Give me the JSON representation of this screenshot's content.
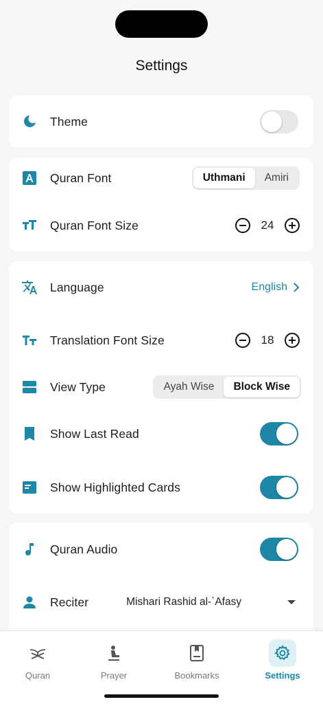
{
  "header": {
    "title": "Settings"
  },
  "colors": {
    "accent": "#1e87a6",
    "toggle_off": "#e8e8e8"
  },
  "appearance": {
    "theme": {
      "label": "Theme",
      "icon": "moon-icon",
      "on": false
    }
  },
  "quran": {
    "font": {
      "label": "Quran Font",
      "icon": "font-a-icon",
      "options": [
        "Uthmani",
        "Amiri"
      ],
      "selected": "Uthmani"
    },
    "font_size": {
      "label": "Quran Font Size",
      "icon": "text-size-icon",
      "value": "24"
    }
  },
  "translation": {
    "language": {
      "label": "Language",
      "icon": "translate-icon",
      "value": "English"
    },
    "font_size": {
      "label": "Translation Font Size",
      "icon": "text-size-icon",
      "value": "18"
    },
    "view_type": {
      "label": "View Type",
      "icon": "view-agenda-icon",
      "options": [
        "Ayah Wise",
        "Block Wise"
      ],
      "selected": "Block Wise"
    },
    "last_read": {
      "label": "Show Last Read",
      "icon": "bookmark-icon",
      "on": true
    },
    "highlighted_cards": {
      "label": "Show Highlighted Cards",
      "icon": "card-icon",
      "on": true
    }
  },
  "audio": {
    "quran_audio": {
      "label": "Quran Audio",
      "icon": "music-note-icon",
      "on": true
    },
    "reciter": {
      "label": "Reciter",
      "icon": "person-icon",
      "value": "Mishari Rashid al-`Afasy"
    }
  },
  "tabs": [
    {
      "label": "Quran",
      "icon": "quran-stand-icon",
      "active": false
    },
    {
      "label": "Prayer",
      "icon": "prayer-person-icon",
      "active": false
    },
    {
      "label": "Bookmarks",
      "icon": "bookmark-book-icon",
      "active": false
    },
    {
      "label": "Settings",
      "icon": "gear-icon",
      "active": true
    }
  ]
}
